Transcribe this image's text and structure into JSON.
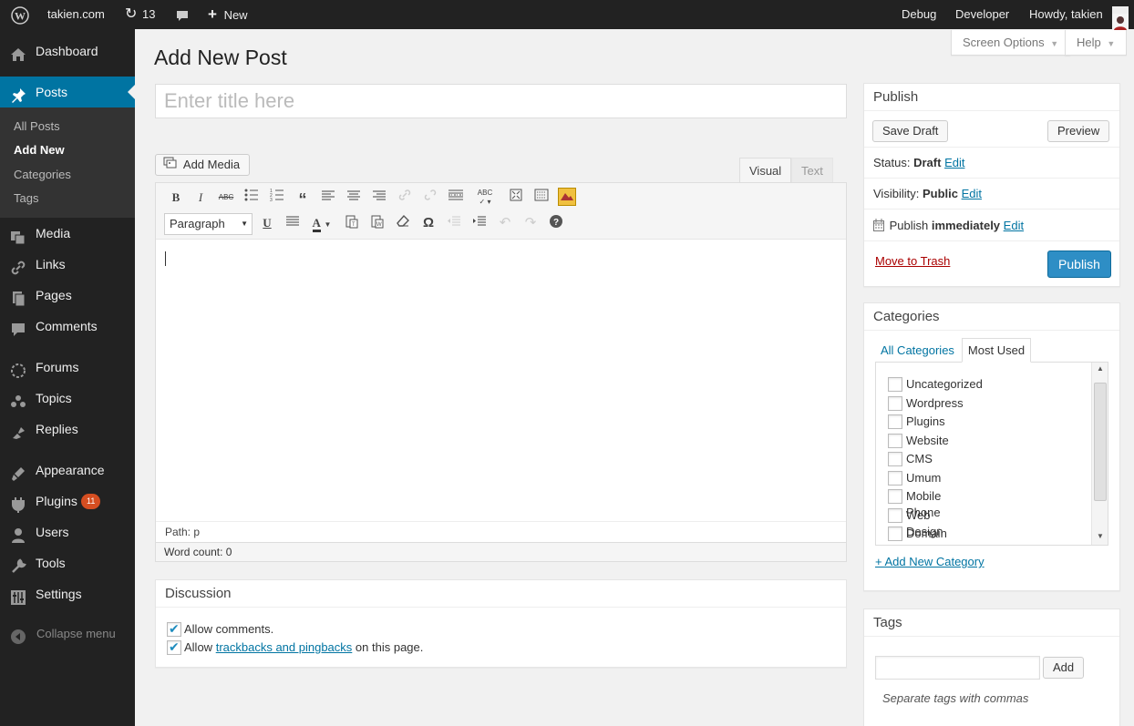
{
  "adminbar": {
    "site_name": "takien.com",
    "updates_count": "13",
    "new_label": "New",
    "debug": "Debug",
    "developer": "Developer",
    "howdy": "Howdy, takien"
  },
  "sidebar": {
    "dashboard": "Dashboard",
    "posts": "Posts",
    "submenu": [
      "All Posts",
      "Add New",
      "Categories",
      "Tags"
    ],
    "media": "Media",
    "links": "Links",
    "pages": "Pages",
    "comments": "Comments",
    "forums": "Forums",
    "topics": "Topics",
    "replies": "Replies",
    "appearance": "Appearance",
    "plugins": "Plugins",
    "plugins_badge": "11",
    "users": "Users",
    "tools": "Tools",
    "settings": "Settings",
    "collapse": "Collapse menu"
  },
  "screen_options": "Screen Options",
  "help": "Help",
  "page_title": "Add New Post",
  "title_placeholder": "Enter title here",
  "editor": {
    "add_media": "Add Media",
    "tab_visual": "Visual",
    "tab_text": "Text",
    "format_select": "Paragraph",
    "path": "Path: p",
    "word_count": "Word count: 0"
  },
  "discussion": {
    "title": "Discussion",
    "allow_comments": "Allow comments.",
    "allow_prefix": "Allow",
    "trackbacks_link": "trackbacks and pingbacks",
    "allow_suffix": "on this page."
  },
  "publish": {
    "title": "Publish",
    "save_draft": "Save Draft",
    "preview": "Preview",
    "status_label": "Status:",
    "status_value": "Draft",
    "visibility_label": "Visibility:",
    "visibility_value": "Public",
    "publish_label": "Publish",
    "publish_value": "immediately",
    "edit": "Edit",
    "move_to_trash": "Move to Trash",
    "publish_button": "Publish"
  },
  "categories": {
    "title": "Categories",
    "tab_all": "All Categories",
    "tab_most_used": "Most Used",
    "items": [
      "Uncategorized",
      "Wordpress",
      "Plugins",
      "Website",
      "CMS",
      "Umum",
      "Mobile Phone",
      "Web Design",
      "Domain"
    ],
    "add_new": "+ Add New Category"
  },
  "tags": {
    "title": "Tags",
    "add_button": "Add",
    "hint": "Separate tags with commas"
  },
  "colors": {
    "accent": "#0074a2",
    "publish_button": "#2e8ec5",
    "trash": "#a00",
    "badge": "#d54e21"
  }
}
